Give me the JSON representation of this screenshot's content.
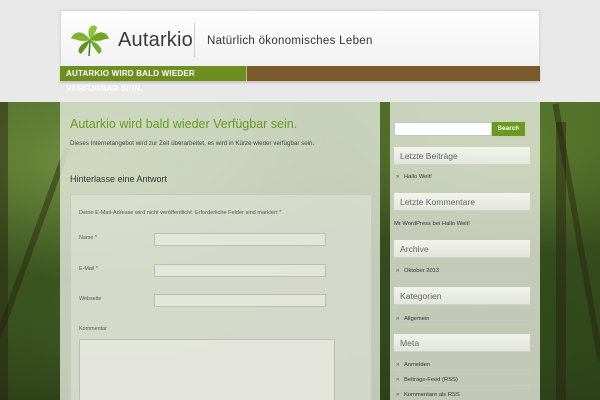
{
  "header": {
    "site_title": "Autarkio",
    "description": "Natürlich ökonomisches Leben",
    "nav_item": "AUTARKIO WIRD BALD WIEDER VERFÜGBAR SEIN."
  },
  "post": {
    "title": "Autarkio wird bald wieder Verfügbar sein.",
    "text": "Dieses Internetangebot wird zur Zeit überarbeitet, es wird in Kürze wieder verfügbar sein."
  },
  "reply": {
    "title": "Hinterlasse eine Antwort",
    "note": "Deine E-Mail-Adresse wird nicht veröffentlicht. Erforderliche Felder sind markiert *",
    "name_label": "Name *",
    "email_label": "E-Mail *",
    "website_label": "Webseite",
    "comment_label": "Kommentar"
  },
  "sidebar": {
    "search_button": "Search",
    "recent_posts_title": "Letzte Beiträge",
    "recent_posts": [
      "Hallo Welt!"
    ],
    "recent_comments_title": "Letzte Kommentare",
    "recent_comment": "Mr WordPress bei Hallo Welt!",
    "archive_title": "Archive",
    "archive_items": [
      "Oktober 2013"
    ],
    "categories_title": "Kategorien",
    "categories": [
      "Allgemein"
    ],
    "meta_title": "Meta",
    "meta_items": [
      "Anmelden",
      "Beitrags-Feed (RSS)",
      "Kommentare als RSS"
    ]
  },
  "colors": {
    "accent_green": "#6a9a1f",
    "nav_brown": "#7a5a2a"
  }
}
